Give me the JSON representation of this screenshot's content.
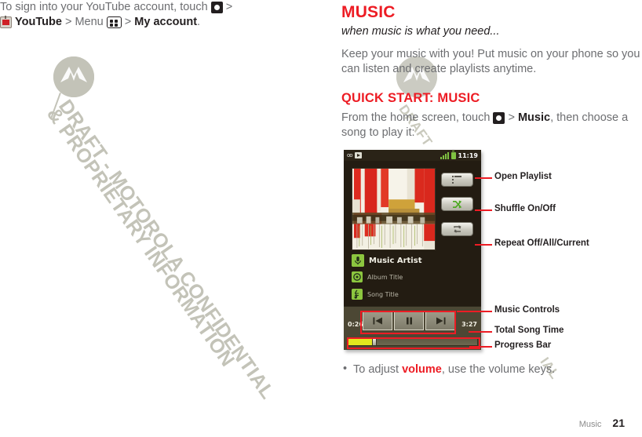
{
  "left_column": {
    "intro_line1_a": "To sign into your YouTube account, touch",
    "intro_line1_b": ">",
    "youtube_label": "YouTube",
    "gt1": ">",
    "menu_label": "Menu",
    "gt2": ">",
    "my_account_label": "My account",
    "period": "."
  },
  "right_column": {
    "section_title": "MUSIC",
    "section_subtitle": "when music is what you need...",
    "section_paragraph": "Keep your music with you! Put music on your phone so you can listen and create playlists anytime.",
    "quick_start_title": "QUICK START: MUSIC",
    "quick_start_text_a": "From the home screen, touch",
    "quick_start_gt": ">",
    "quick_start_music": "Music",
    "quick_start_text_b": ", then choose a song to play it:",
    "bullet_a": "To adjust",
    "bullet_volume": "volume",
    "bullet_b": ", use the volume keys."
  },
  "phone": {
    "status": {
      "voicemail_icon": "voicemail-icon",
      "play_icon": "now-playing-icon",
      "signal_icon": "signal-bars-icon",
      "battery_icon": "battery-icon",
      "time": "11:19"
    },
    "album_art_alt": "album-artwork",
    "metadata": {
      "artist": "Music Artist",
      "album": "Album Title",
      "song": "Song Title",
      "artist_icon": "microphone-icon",
      "album_icon": "disc-icon",
      "song_icon": "music-note-icon"
    },
    "side_buttons": [
      {
        "name": "playlist-button",
        "icon": "list-icon"
      },
      {
        "name": "shuffle-button",
        "icon": "shuffle-icon"
      },
      {
        "name": "repeat-button",
        "icon": "repeat-icon"
      }
    ],
    "transport": {
      "elapsed_time": "0:26",
      "total_time": "3:27",
      "previous_icon": "skip-previous-icon",
      "pause_icon": "pause-icon",
      "next_icon": "skip-next-icon",
      "progress_percent": 19
    }
  },
  "callouts": [
    {
      "label": "Open Playlist"
    },
    {
      "label": "Shuffle On/Off"
    },
    {
      "label": "Repeat Off/All/Current"
    },
    {
      "label": "Music Controls"
    },
    {
      "label": "Total Song Time"
    },
    {
      "label": "Progress Bar"
    }
  ],
  "watermark": {
    "line1": "DRAFT - MOTOROLA CONFIDENTIAL",
    "line2": "& PROPRIETARY INFORMATION",
    "small1": "DRAFT",
    "small2": "IAL"
  },
  "footer": {
    "chapter": "Music",
    "page_number": "21"
  },
  "colors": {
    "accent_red": "#ed1c24",
    "body_gray": "#6d6e71",
    "dark": "#231f20",
    "phone_bg": "#231c12",
    "green": "#8cc63f",
    "progress_yellow": "#e2e81e"
  }
}
